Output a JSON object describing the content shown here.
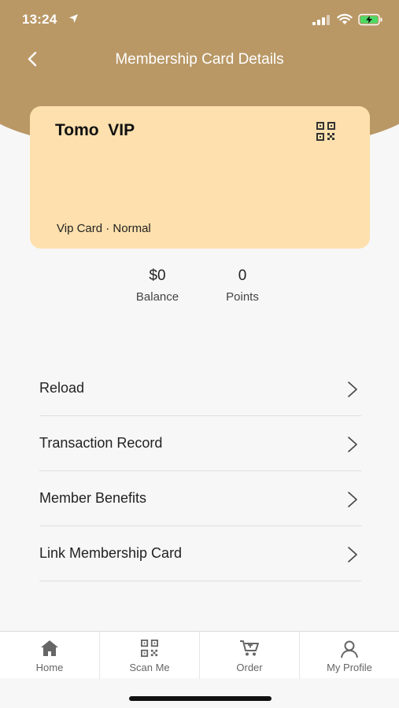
{
  "status_bar": {
    "time": "13:24"
  },
  "nav": {
    "title": "Membership Card Details"
  },
  "card": {
    "name": "Tomo  VIP",
    "type_line": "Vip Card · Normal",
    "background_color": "#fde0ad"
  },
  "stats": {
    "balance_value": "$0",
    "balance_label": "Balance",
    "points_value": "0",
    "points_label": "Points"
  },
  "menu": {
    "items": [
      {
        "label": "Reload"
      },
      {
        "label": "Transaction Record"
      },
      {
        "label": "Member Benefits"
      },
      {
        "label": "Link Membership Card"
      }
    ]
  },
  "tab_bar": {
    "tabs": [
      {
        "label": "Home",
        "icon": "home-icon"
      },
      {
        "label": "Scan Me",
        "icon": "qr-code-icon"
      },
      {
        "label": "Order",
        "icon": "cart-icon"
      },
      {
        "label": "My Profile",
        "icon": "profile-icon"
      }
    ]
  },
  "colors": {
    "header": "#b99866",
    "page_background": "#f7f7f7"
  }
}
